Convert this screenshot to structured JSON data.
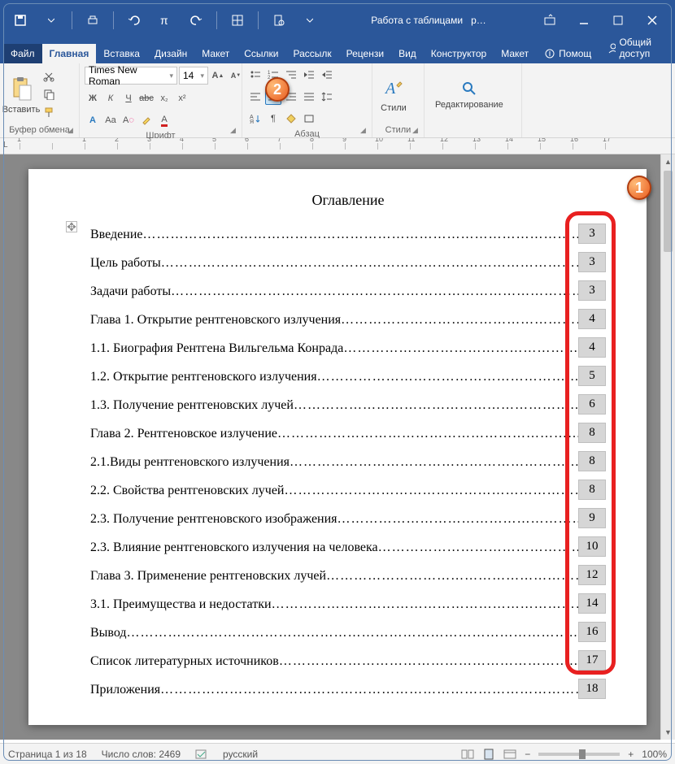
{
  "titlebar": {
    "tabletools": "Работа с таблицами",
    "docname": "р…"
  },
  "tabs": {
    "file": "Файл",
    "home": "Главная",
    "insert": "Вставка",
    "design": "Дизайн",
    "layout": "Макет",
    "references": "Ссылки",
    "mailings": "Рассылк",
    "review": "Рецензи",
    "view": "Вид",
    "tdesign": "Конструктор",
    "tlayout": "Макет",
    "help": "Помощ",
    "share": "Общий доступ"
  },
  "ribbon": {
    "clipboard": {
      "paste": "Вставить",
      "label": "Буфер обмена"
    },
    "font": {
      "name": "Times New Roman",
      "size": "14",
      "label": "Шрифт"
    },
    "paragraph": {
      "label": "Абзац"
    },
    "styles": {
      "btn": "Стили",
      "label": "Стили"
    },
    "editing": {
      "btn": "Редактирование"
    }
  },
  "document": {
    "title": "Оглавление",
    "toc": [
      {
        "text": "Введение",
        "page": "3"
      },
      {
        "text": " Цель работы",
        "page": "3"
      },
      {
        "text": "Задачи работы",
        "page": "3"
      },
      {
        "text": "Глава 1. Открытие рентгеновского излучения",
        "page": "4"
      },
      {
        "text": "1.1. Биография Рентгена Вильгельма Конрада",
        "page": "4"
      },
      {
        "text": "1.2. Открытие рентгеновского излучения ",
        "page": "5"
      },
      {
        "text": "1.3. Получение рентгеновских лучей",
        "page": "6"
      },
      {
        "text": "Глава 2. Рентгеновское излучение",
        "page": "8"
      },
      {
        "text": "2.1.Виды рентгеновского излучения",
        "page": "8"
      },
      {
        "text": "2.2. Свойства рентгеновских лучей",
        "page": "8"
      },
      {
        "text": "2.3. Получение рентгеновского изображения",
        "page": "9"
      },
      {
        "text": "2.3. Влияние рентгеновского излучения на человека",
        "page": "10"
      },
      {
        "text": "Глава 3. Применение рентгеновских лучей",
        "page": "12"
      },
      {
        "text": "3.1. Преимущества и недостатки",
        "page": "14"
      },
      {
        "text": "Вывод",
        "page": "16"
      },
      {
        "text": "Список литературных источников",
        "page": "17"
      },
      {
        "text": "Приложения",
        "page": "18"
      }
    ]
  },
  "statusbar": {
    "page": "Страница 1 из 18",
    "words": "Число слов: 2469",
    "lang": "русский",
    "zoom": "100%"
  },
  "ruler": [
    "1",
    "",
    "1",
    "2",
    "3",
    "4",
    "5",
    "6",
    "7",
    "8",
    "9",
    "10",
    "11",
    "12",
    "13",
    "14",
    "15",
    "16",
    "17"
  ]
}
